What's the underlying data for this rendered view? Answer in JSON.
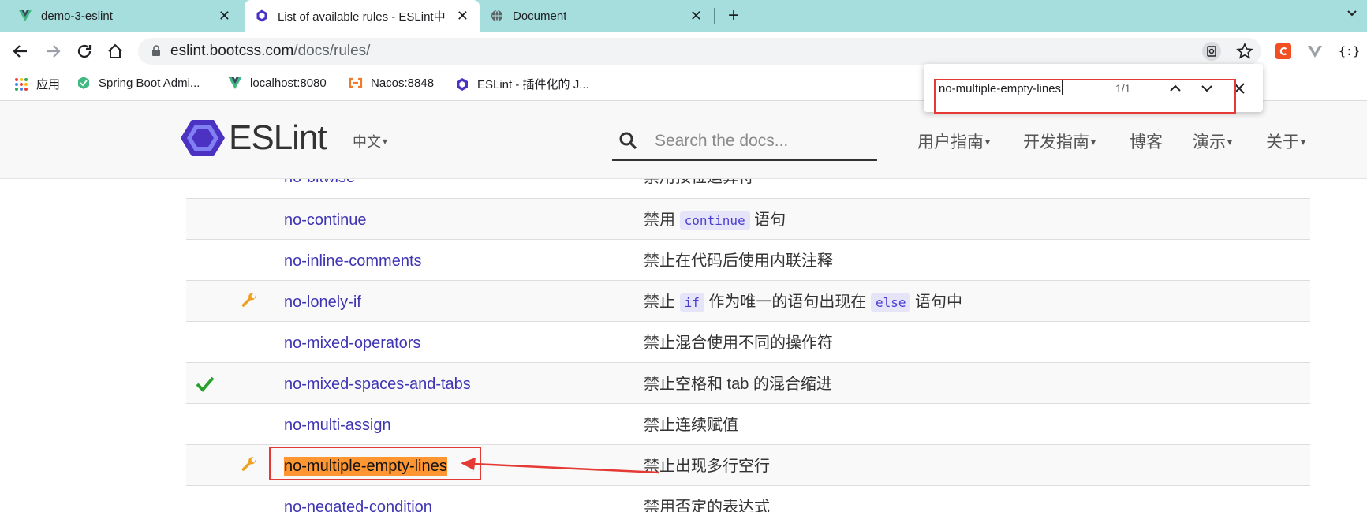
{
  "browser": {
    "tabs": [
      {
        "title": "demo-3-eslint",
        "active": false,
        "icon": "vue-icon"
      },
      {
        "title": "List of available rules - ESLint中",
        "active": true,
        "icon": "eslint-icon"
      },
      {
        "title": "Document",
        "active": false,
        "icon": "globe-icon"
      }
    ],
    "url_host": "eslint.bootcss.com",
    "url_path": "/docs/rules/",
    "bookmarks": [
      {
        "label": "应用",
        "icon": "apps-grid-icon"
      },
      {
        "label": "Spring Boot Admi...",
        "icon": "spring-boot-admin-icon"
      },
      {
        "label": "localhost:8080",
        "icon": "vue-icon"
      },
      {
        "label": "Nacos:8848",
        "icon": "nacos-icon"
      },
      {
        "label": "ESLint - 插件化的 J...",
        "icon": "eslint-icon"
      }
    ]
  },
  "find_bar": {
    "query": "no-multiple-empty-lines",
    "count": "1/1"
  },
  "site": {
    "logo_text": "ESLint",
    "language": "中文",
    "search_placeholder": "Search the docs...",
    "nav": [
      "用户指南",
      "开发指南",
      "博客",
      "演示",
      "关于"
    ]
  },
  "rules": [
    {
      "name": "no-bitwise",
      "desc": "禁用按位运算符",
      "recommended": false,
      "fixable": false
    },
    {
      "name": "no-continue",
      "desc_parts": [
        "禁用 ",
        "continue",
        " 语句"
      ],
      "recommended": false,
      "fixable": false
    },
    {
      "name": "no-inline-comments",
      "desc": "禁止在代码后使用内联注释",
      "recommended": false,
      "fixable": false
    },
    {
      "name": "no-lonely-if",
      "desc_parts": [
        "禁止 ",
        "if",
        " 作为唯一的语句出现在 ",
        "else",
        " 语句中"
      ],
      "recommended": false,
      "fixable": true
    },
    {
      "name": "no-mixed-operators",
      "desc": "禁止混合使用不同的操作符",
      "recommended": false,
      "fixable": false
    },
    {
      "name": "no-mixed-spaces-and-tabs",
      "desc": "禁止空格和 tab 的混合缩进",
      "recommended": true,
      "fixable": false
    },
    {
      "name": "no-multi-assign",
      "desc": "禁止连续赋值",
      "recommended": false,
      "fixable": false
    },
    {
      "name": "no-multiple-empty-lines",
      "desc": "禁止出现多行空行",
      "recommended": false,
      "fixable": true,
      "highlighted": true
    },
    {
      "name": "no-negated-condition",
      "desc": "禁用否定的表达式",
      "recommended": false,
      "fixable": false
    }
  ],
  "colors": {
    "tabstrip": "#a6dede",
    "link": "#3f35b3",
    "highlight": "#ff9632",
    "annotation_red": "#e53935",
    "wrench": "#f0a020",
    "check": "#2ca02c"
  }
}
